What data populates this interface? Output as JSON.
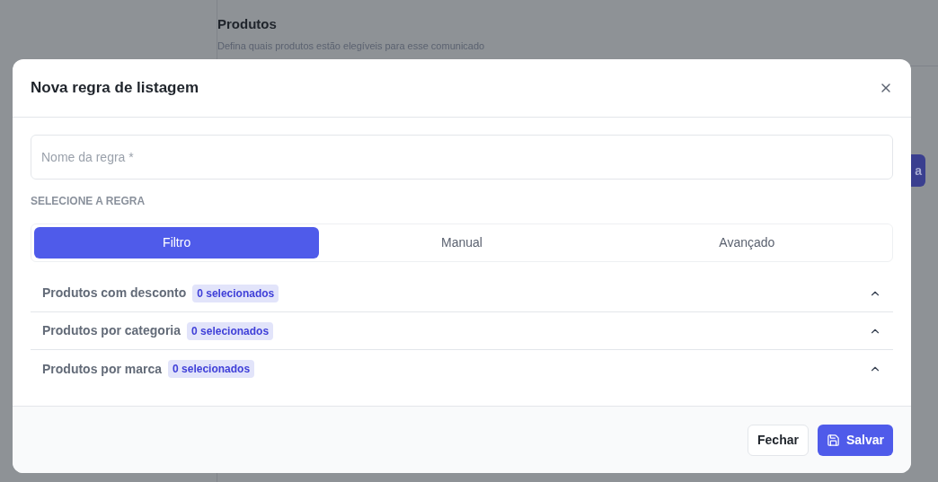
{
  "page": {
    "section_title": "Produtos",
    "section_subtitle": "Defina quais produtos estão elegíveis para esse comunicado",
    "partial_button": "a"
  },
  "dialog": {
    "title": "Nova regra de listagem",
    "name_field": {
      "placeholder": "Nome da regra *"
    },
    "rule_label": "SELECIONE A REGRA",
    "tabs": [
      {
        "label": "Filtro",
        "selected": true
      },
      {
        "label": "Manual",
        "selected": false
      },
      {
        "label": "Avançado",
        "selected": false
      }
    ],
    "filters": [
      {
        "label": "Produtos com desconto",
        "badge": "0 selecionados"
      },
      {
        "label": "Produtos por categoria",
        "badge": "0 selecionados"
      },
      {
        "label": "Produtos por marca",
        "badge": "0 selecionados"
      }
    ],
    "buttons": [
      {
        "label": "Fechar",
        "kind": "secondary"
      },
      {
        "label": "Salvar",
        "kind": "primary"
      }
    ]
  }
}
